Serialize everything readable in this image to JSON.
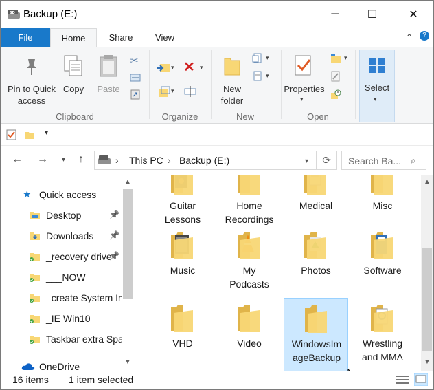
{
  "window": {
    "title": "Backup (E:)",
    "controls": {
      "minimize": "─",
      "maximize": "☐",
      "close": "✕"
    }
  },
  "ribbon_tabs": [
    "File",
    "Home",
    "Share",
    "View"
  ],
  "ribbon": {
    "clipboard": {
      "pin": "Pin to Quick access",
      "copy": "Copy",
      "paste": "Paste",
      "label": "Clipboard"
    },
    "organize": {
      "label": "Organize"
    },
    "new": {
      "new_folder": "New folder",
      "label": "New"
    },
    "open": {
      "properties": "Properties",
      "label": "Open"
    },
    "select": {
      "label": "Select"
    }
  },
  "address": {
    "crumbs": [
      "This PC",
      "Backup (E:)"
    ],
    "search_placeholder": "Search Ba..."
  },
  "nav_pane": {
    "quick_access": "Quick access",
    "items": [
      {
        "label": "Desktop",
        "pinned": true
      },
      {
        "label": "Downloads",
        "pinned": true
      },
      {
        "label": "_recovery drive",
        "pinned": true
      },
      {
        "label": "___NOW",
        "pinned": false
      },
      {
        "label": "_create System Image",
        "pinned": false
      },
      {
        "label": "_IE Win10",
        "pinned": false
      },
      {
        "label": "Taskbar extra Space",
        "pinned": false
      }
    ],
    "onedrive": "OneDrive"
  },
  "folders": [
    {
      "line1": "Guitar",
      "line2": "Lessons",
      "icon": "guitar-folder-icon"
    },
    {
      "line1": "Home",
      "line2": "Recordings",
      "icon": "folder-icon"
    },
    {
      "line1": "Medical",
      "line2": "",
      "icon": "document-folder-icon"
    },
    {
      "line1": "Misc",
      "line2": "",
      "icon": "folder-icon"
    },
    {
      "line1": "Music",
      "line2": "",
      "icon": "music-folder-icon"
    },
    {
      "line1": "My",
      "line2": "Podcasts",
      "icon": "vlc-folder-icon"
    },
    {
      "line1": "Photos",
      "line2": "",
      "icon": "photos-folder-icon"
    },
    {
      "line1": "Software",
      "line2": "",
      "icon": "software-folder-icon"
    },
    {
      "line1": "VHD",
      "line2": "",
      "icon": "folder-icon"
    },
    {
      "line1": "Video",
      "line2": "",
      "icon": "folder-icon"
    },
    {
      "line1": "WindowsIm",
      "line2": "ageBackup",
      "icon": "folder-icon",
      "selected": true
    },
    {
      "line1": "Wrestling",
      "line2": "and MMA",
      "icon": "wrestling-folder-icon"
    }
  ],
  "status": {
    "count": "16 items",
    "selected": "1 item selected"
  },
  "colors": {
    "accent": "#1979ca",
    "folder": "#f8d775",
    "folder_dark": "#e0b44a",
    "selection": "#cce8ff",
    "sync_green": "#3fa33f"
  }
}
